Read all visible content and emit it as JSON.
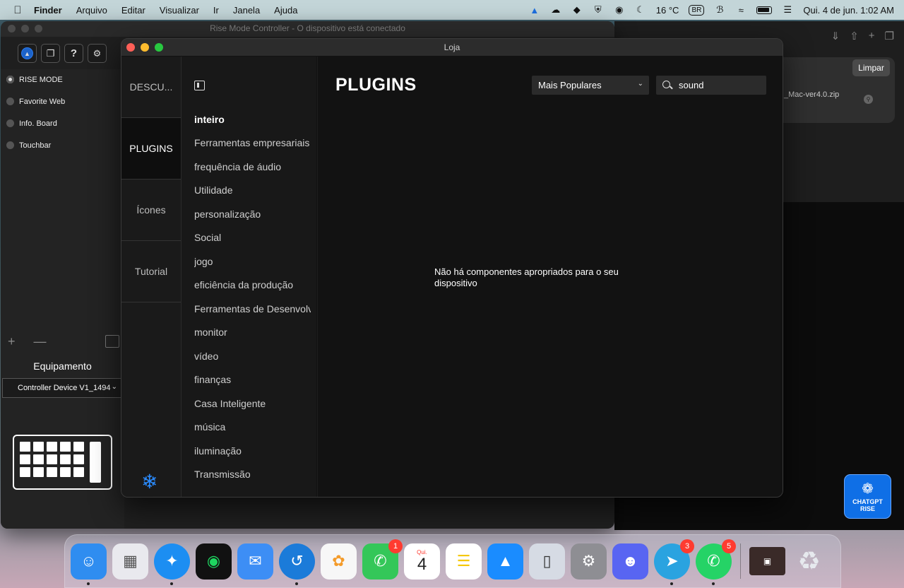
{
  "menubar": {
    "app_name": "Finder",
    "menus": [
      "Arquivo",
      "Editar",
      "Visualizar",
      "Ir",
      "Janela",
      "Ajuda"
    ],
    "weather": "16 °C",
    "input_source": "BR",
    "datetime": "Qui. 4 de jun.  1:02 AM"
  },
  "rm_window": {
    "title": "Rise Mode Controller - O dispositivo está conectado",
    "modes": [
      "RISE MODE",
      "Favorite Web",
      "Info. Board",
      "Touchbar"
    ],
    "plus": "+",
    "minus": "—",
    "equip_label": "Equipamento",
    "device": "Controller Device V1_1494"
  },
  "browser": {
    "limpar_label": "Limpar",
    "download_filename": "_Mac-ver4.0.zip",
    "chatgpt_label": "CHATGPT RISE"
  },
  "store": {
    "window_title": "Loja",
    "nav_tabs": [
      "DESCU...",
      "PLUGINS",
      "Ícones",
      "Tutorial"
    ],
    "categories": [
      "inteiro",
      "Ferramentas empresariais",
      "frequência de áudio",
      "Utilidade",
      "personalização",
      "Social",
      "jogo",
      "eficiência da produção",
      "Ferramentas de Desenvolvimento",
      "monitor",
      "vídeo",
      "finanças",
      "Casa Inteligente",
      "música",
      "iluminação",
      "Transmissão"
    ],
    "main_title": "PLUGINS",
    "sort_value": "Mais Populares",
    "search_value": "sound",
    "empty_message": "Não há componentes apropriados para o seu dispositivo"
  },
  "dock": {
    "calendar_month": "Qui.",
    "calendar_day": "4",
    "badges": {
      "phone": "1",
      "telegram": "3",
      "whatsapp": "5"
    },
    "colors": {
      "finder": "#2f8df0",
      "launchpad": "#e9e9ee",
      "safari": "#1c8ef2",
      "spotify": "#111111",
      "mail": "#3d8ef5",
      "edge": "#1b7bd9",
      "photos": "#f7f7f7",
      "phone": "#34c759",
      "calendar": "#ffffff",
      "notes": "#ffffff",
      "appstore": "#1a8cff",
      "iphone_mirroring": "#d6dbe4",
      "settings": "#8e8e93",
      "discord": "#5865f2",
      "telegram": "#2aa3e0",
      "whatsapp": "#25d366",
      "trash": "#d9dde2"
    }
  }
}
